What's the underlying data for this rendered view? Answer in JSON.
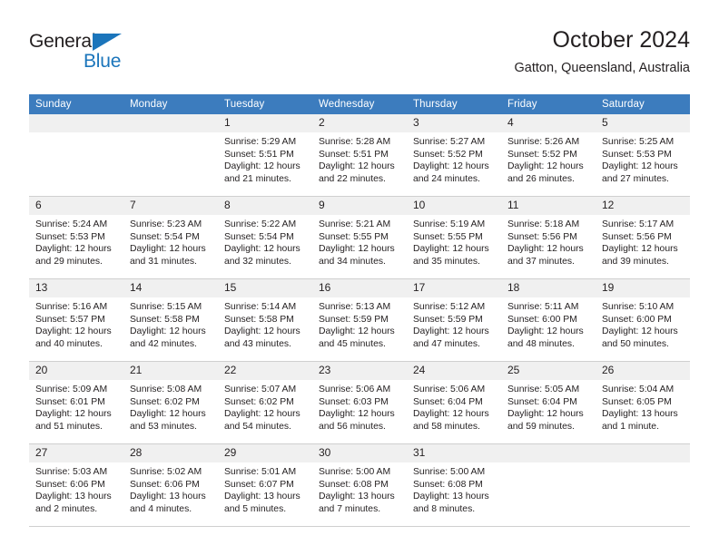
{
  "brand": {
    "name_part1": "General",
    "name_part2": "Blue",
    "triangle_color": "#1b75bb",
    "text_color": "#231f20"
  },
  "header": {
    "title": "October 2024",
    "subtitle": "Gatton, Queensland, Australia"
  },
  "theme": {
    "header_blue": "#3c7ebe",
    "daynum_band": "#f0f0f0",
    "grid_line": "#cfcfcf",
    "text": "#231f20"
  },
  "calendar": {
    "weekdays": [
      "Sunday",
      "Monday",
      "Tuesday",
      "Wednesday",
      "Thursday",
      "Friday",
      "Saturday"
    ],
    "labels": {
      "sunrise": "Sunrise:",
      "sunset": "Sunset:",
      "daylight": "Daylight:"
    },
    "weeks": [
      [
        {
          "day": "",
          "empty": true
        },
        {
          "day": "",
          "empty": true
        },
        {
          "day": "1",
          "sunrise": "Sunrise: 5:29 AM",
          "sunset": "Sunset: 5:51 PM",
          "daylight_1": "Daylight: 12 hours",
          "daylight_2": "and 21 minutes."
        },
        {
          "day": "2",
          "sunrise": "Sunrise: 5:28 AM",
          "sunset": "Sunset: 5:51 PM",
          "daylight_1": "Daylight: 12 hours",
          "daylight_2": "and 22 minutes."
        },
        {
          "day": "3",
          "sunrise": "Sunrise: 5:27 AM",
          "sunset": "Sunset: 5:52 PM",
          "daylight_1": "Daylight: 12 hours",
          "daylight_2": "and 24 minutes."
        },
        {
          "day": "4",
          "sunrise": "Sunrise: 5:26 AM",
          "sunset": "Sunset: 5:52 PM",
          "daylight_1": "Daylight: 12 hours",
          "daylight_2": "and 26 minutes."
        },
        {
          "day": "5",
          "sunrise": "Sunrise: 5:25 AM",
          "sunset": "Sunset: 5:53 PM",
          "daylight_1": "Daylight: 12 hours",
          "daylight_2": "and 27 minutes."
        }
      ],
      [
        {
          "day": "6",
          "sunrise": "Sunrise: 5:24 AM",
          "sunset": "Sunset: 5:53 PM",
          "daylight_1": "Daylight: 12 hours",
          "daylight_2": "and 29 minutes."
        },
        {
          "day": "7",
          "sunrise": "Sunrise: 5:23 AM",
          "sunset": "Sunset: 5:54 PM",
          "daylight_1": "Daylight: 12 hours",
          "daylight_2": "and 31 minutes."
        },
        {
          "day": "8",
          "sunrise": "Sunrise: 5:22 AM",
          "sunset": "Sunset: 5:54 PM",
          "daylight_1": "Daylight: 12 hours",
          "daylight_2": "and 32 minutes."
        },
        {
          "day": "9",
          "sunrise": "Sunrise: 5:21 AM",
          "sunset": "Sunset: 5:55 PM",
          "daylight_1": "Daylight: 12 hours",
          "daylight_2": "and 34 minutes."
        },
        {
          "day": "10",
          "sunrise": "Sunrise: 5:19 AM",
          "sunset": "Sunset: 5:55 PM",
          "daylight_1": "Daylight: 12 hours",
          "daylight_2": "and 35 minutes."
        },
        {
          "day": "11",
          "sunrise": "Sunrise: 5:18 AM",
          "sunset": "Sunset: 5:56 PM",
          "daylight_1": "Daylight: 12 hours",
          "daylight_2": "and 37 minutes."
        },
        {
          "day": "12",
          "sunrise": "Sunrise: 5:17 AM",
          "sunset": "Sunset: 5:56 PM",
          "daylight_1": "Daylight: 12 hours",
          "daylight_2": "and 39 minutes."
        }
      ],
      [
        {
          "day": "13",
          "sunrise": "Sunrise: 5:16 AM",
          "sunset": "Sunset: 5:57 PM",
          "daylight_1": "Daylight: 12 hours",
          "daylight_2": "and 40 minutes."
        },
        {
          "day": "14",
          "sunrise": "Sunrise: 5:15 AM",
          "sunset": "Sunset: 5:58 PM",
          "daylight_1": "Daylight: 12 hours",
          "daylight_2": "and 42 minutes."
        },
        {
          "day": "15",
          "sunrise": "Sunrise: 5:14 AM",
          "sunset": "Sunset: 5:58 PM",
          "daylight_1": "Daylight: 12 hours",
          "daylight_2": "and 43 minutes."
        },
        {
          "day": "16",
          "sunrise": "Sunrise: 5:13 AM",
          "sunset": "Sunset: 5:59 PM",
          "daylight_1": "Daylight: 12 hours",
          "daylight_2": "and 45 minutes."
        },
        {
          "day": "17",
          "sunrise": "Sunrise: 5:12 AM",
          "sunset": "Sunset: 5:59 PM",
          "daylight_1": "Daylight: 12 hours",
          "daylight_2": "and 47 minutes."
        },
        {
          "day": "18",
          "sunrise": "Sunrise: 5:11 AM",
          "sunset": "Sunset: 6:00 PM",
          "daylight_1": "Daylight: 12 hours",
          "daylight_2": "and 48 minutes."
        },
        {
          "day": "19",
          "sunrise": "Sunrise: 5:10 AM",
          "sunset": "Sunset: 6:00 PM",
          "daylight_1": "Daylight: 12 hours",
          "daylight_2": "and 50 minutes."
        }
      ],
      [
        {
          "day": "20",
          "sunrise": "Sunrise: 5:09 AM",
          "sunset": "Sunset: 6:01 PM",
          "daylight_1": "Daylight: 12 hours",
          "daylight_2": "and 51 minutes."
        },
        {
          "day": "21",
          "sunrise": "Sunrise: 5:08 AM",
          "sunset": "Sunset: 6:02 PM",
          "daylight_1": "Daylight: 12 hours",
          "daylight_2": "and 53 minutes."
        },
        {
          "day": "22",
          "sunrise": "Sunrise: 5:07 AM",
          "sunset": "Sunset: 6:02 PM",
          "daylight_1": "Daylight: 12 hours",
          "daylight_2": "and 54 minutes."
        },
        {
          "day": "23",
          "sunrise": "Sunrise: 5:06 AM",
          "sunset": "Sunset: 6:03 PM",
          "daylight_1": "Daylight: 12 hours",
          "daylight_2": "and 56 minutes."
        },
        {
          "day": "24",
          "sunrise": "Sunrise: 5:06 AM",
          "sunset": "Sunset: 6:04 PM",
          "daylight_1": "Daylight: 12 hours",
          "daylight_2": "and 58 minutes."
        },
        {
          "day": "25",
          "sunrise": "Sunrise: 5:05 AM",
          "sunset": "Sunset: 6:04 PM",
          "daylight_1": "Daylight: 12 hours",
          "daylight_2": "and 59 minutes."
        },
        {
          "day": "26",
          "sunrise": "Sunrise: 5:04 AM",
          "sunset": "Sunset: 6:05 PM",
          "daylight_1": "Daylight: 13 hours",
          "daylight_2": "and 1 minute."
        }
      ],
      [
        {
          "day": "27",
          "sunrise": "Sunrise: 5:03 AM",
          "sunset": "Sunset: 6:06 PM",
          "daylight_1": "Daylight: 13 hours",
          "daylight_2": "and 2 minutes."
        },
        {
          "day": "28",
          "sunrise": "Sunrise: 5:02 AM",
          "sunset": "Sunset: 6:06 PM",
          "daylight_1": "Daylight: 13 hours",
          "daylight_2": "and 4 minutes."
        },
        {
          "day": "29",
          "sunrise": "Sunrise: 5:01 AM",
          "sunset": "Sunset: 6:07 PM",
          "daylight_1": "Daylight: 13 hours",
          "daylight_2": "and 5 minutes."
        },
        {
          "day": "30",
          "sunrise": "Sunrise: 5:00 AM",
          "sunset": "Sunset: 6:08 PM",
          "daylight_1": "Daylight: 13 hours",
          "daylight_2": "and 7 minutes."
        },
        {
          "day": "31",
          "sunrise": "Sunrise: 5:00 AM",
          "sunset": "Sunset: 6:08 PM",
          "daylight_1": "Daylight: 13 hours",
          "daylight_2": "and 8 minutes."
        },
        {
          "day": "",
          "empty": true
        },
        {
          "day": "",
          "empty": true
        }
      ]
    ]
  }
}
